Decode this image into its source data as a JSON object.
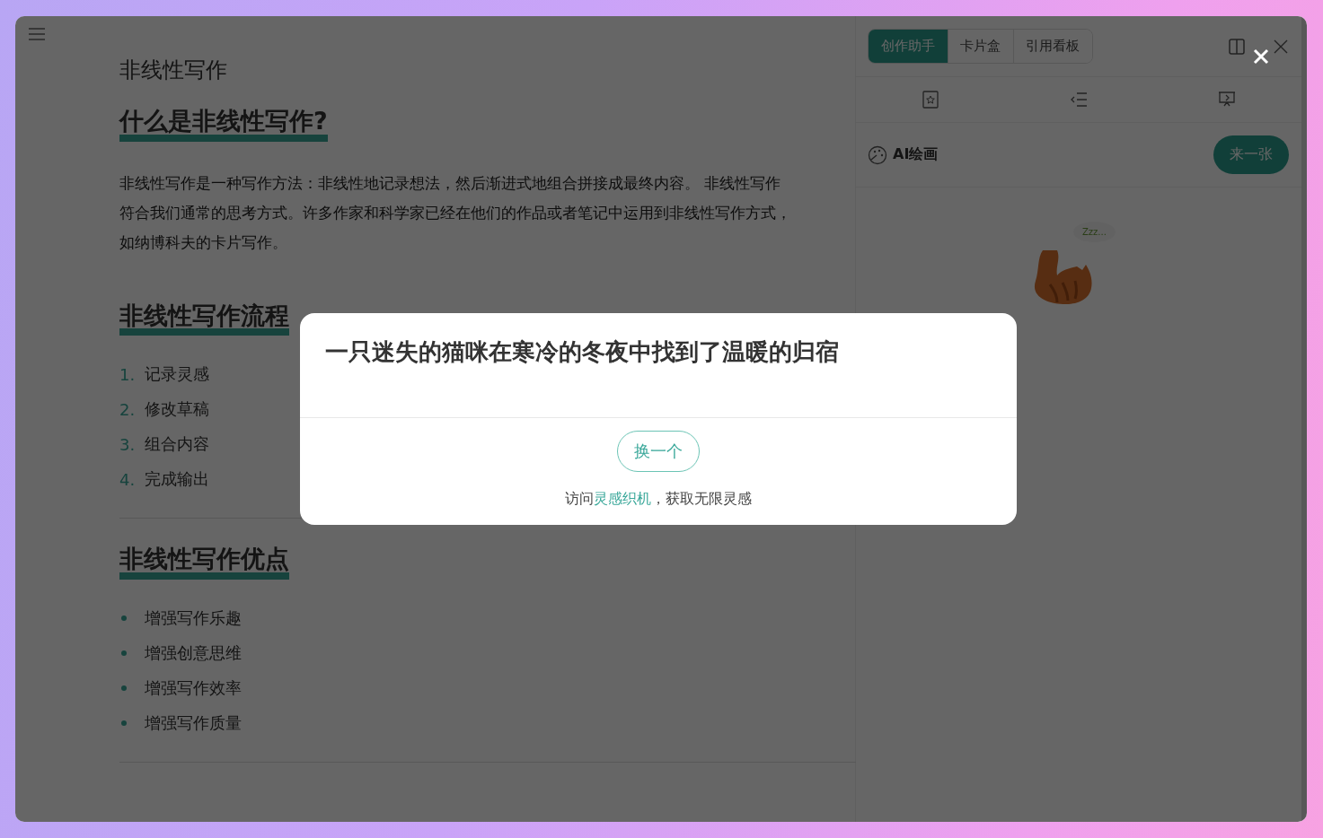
{
  "document": {
    "title": "非线性写作",
    "sections": [
      {
        "heading": "什么是非线性写作?",
        "kind": "paragraph",
        "lines": [
          "非线性写作是一种写作方法：非线性地记录想法，然后渐进式地组合拼接成最终内容。 非线性写作",
          "符合我们通常的思考方式。许多作家和科学家已经在他们的作品或者笔记中运用到非线性写作方式，",
          "如纳博科夫的卡片写作。"
        ]
      },
      {
        "heading": "非线性写作流程",
        "kind": "ordered",
        "items": [
          {
            "number": "1.",
            "text": "记录灵感"
          },
          {
            "number": "2.",
            "text": "修改草稿"
          },
          {
            "number": "3.",
            "text": "组合内容"
          },
          {
            "number": "4.",
            "text": "完成输出"
          }
        ]
      },
      {
        "heading": "非线性写作优点",
        "kind": "bullets",
        "items": [
          {
            "text": "增强写作乐趣"
          },
          {
            "text": "增强创意思维"
          },
          {
            "text": "增强写作效率"
          },
          {
            "text": "增强写作质量"
          }
        ]
      }
    ]
  },
  "side_panel": {
    "tabs": [
      {
        "label": "创作助手",
        "selected": true
      },
      {
        "label": "卡片盒",
        "selected": false
      },
      {
        "label": "引用看板",
        "selected": false
      }
    ],
    "ai_drawing": {
      "label": "AI绘画",
      "button": "来一张"
    },
    "illustration": {
      "bubble_text": "Zzz..."
    }
  },
  "modal": {
    "title": "一只迷失的猫咪在寒冷的冬夜中找到了温暖的归宿",
    "button": "换一个",
    "footer": {
      "before": "访问",
      "link": "灵感织机",
      "after": "，获取无限灵感"
    }
  }
}
